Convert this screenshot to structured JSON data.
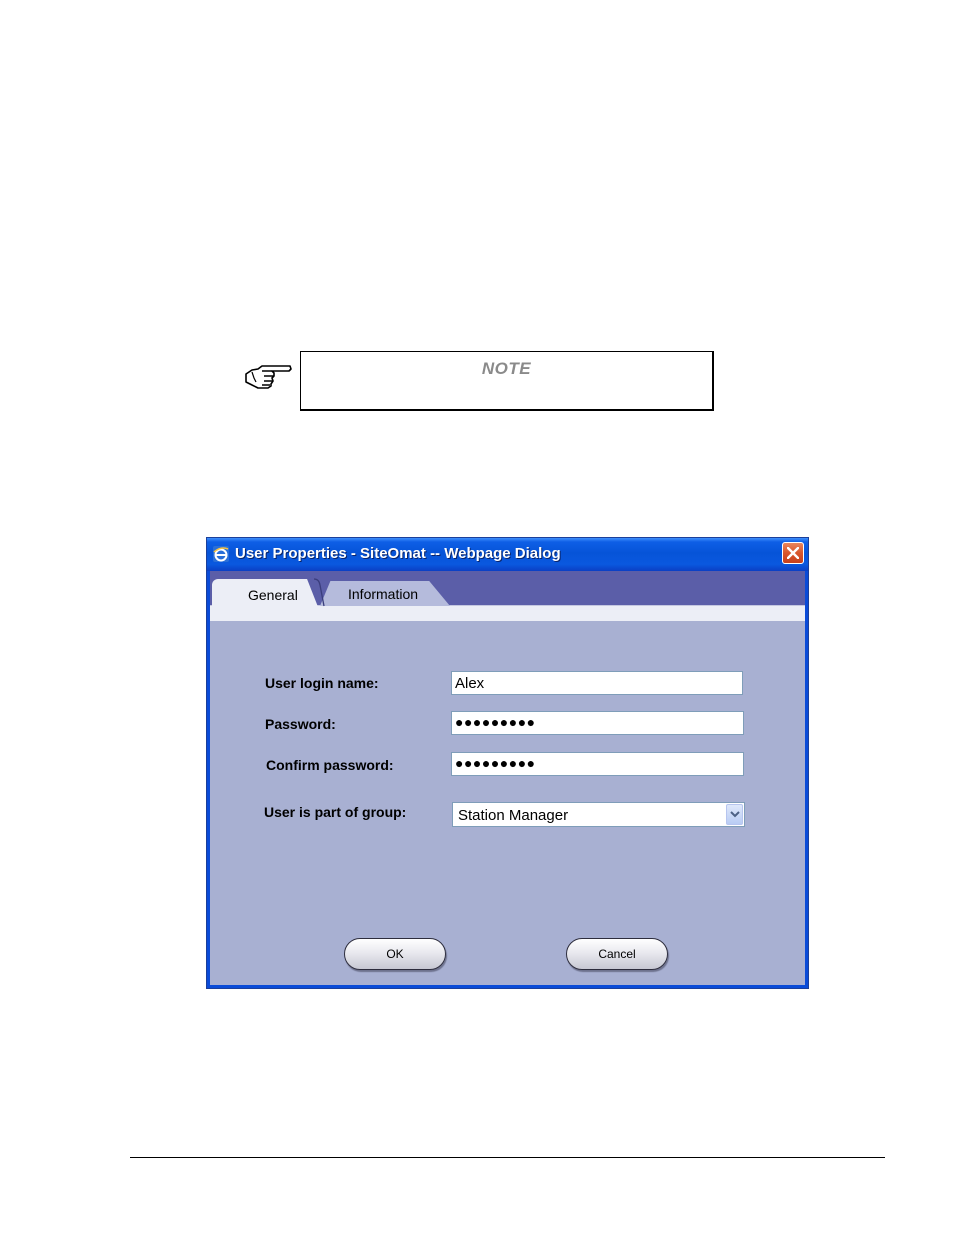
{
  "note": {
    "title": "NOTE"
  },
  "dialog": {
    "title": "User Properties - SiteOmat -- Webpage Dialog",
    "tabs": [
      {
        "label": "General",
        "active": true
      },
      {
        "label": "Information",
        "active": false
      }
    ],
    "fields": {
      "login_label": "User login name:",
      "login_value": "Alex",
      "password_label": "Password:",
      "password_value": "●●●●●●●●●",
      "confirm_label": "Confirm password:",
      "confirm_value": "●●●●●●●●●",
      "group_label": "User is part of group:",
      "group_value": "Station Manager"
    },
    "buttons": {
      "ok": "OK",
      "cancel": "Cancel"
    }
  },
  "colors": {
    "titlebar": "#0654d8",
    "client": "#a8b0d2",
    "tabstrip": "#5b5ea8",
    "close": "#d8562c"
  }
}
